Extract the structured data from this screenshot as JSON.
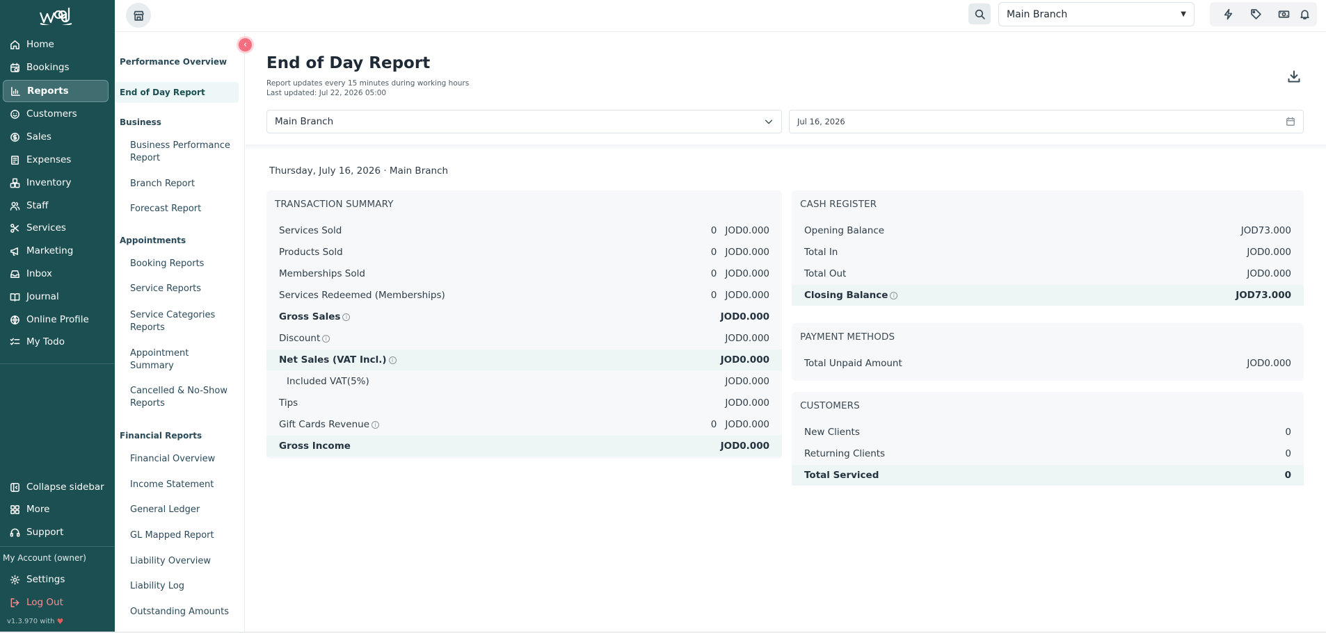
{
  "brand": {
    "logo_text": "waq"
  },
  "nav": {
    "items": [
      {
        "label": "Home",
        "icon": "home-icon"
      },
      {
        "label": "Bookings",
        "icon": "calendar-icon"
      },
      {
        "label": "Reports",
        "icon": "bar-chart-icon",
        "active": true
      },
      {
        "label": "Customers",
        "icon": "smile-icon"
      },
      {
        "label": "Sales",
        "icon": "coin-icon"
      },
      {
        "label": "Expenses",
        "icon": "receipt-icon"
      },
      {
        "label": "Inventory",
        "icon": "boxes-icon"
      },
      {
        "label": "Staff",
        "icon": "users-icon"
      },
      {
        "label": "Services",
        "icon": "scissors-icon"
      },
      {
        "label": "Marketing",
        "icon": "megaphone-icon"
      },
      {
        "label": "Inbox",
        "icon": "inbox-icon"
      },
      {
        "label": "Journal",
        "icon": "book-icon"
      },
      {
        "label": "Online Profile",
        "icon": "globe-icon"
      },
      {
        "label": "My Todo",
        "icon": "checklist-icon"
      }
    ],
    "bottom": {
      "collapse": "Collapse sidebar",
      "more": "More",
      "support": "Support",
      "account": "My Account  (owner)",
      "settings": "Settings",
      "logout": "Log Out",
      "version": "v1.3.970 with"
    }
  },
  "subnav": {
    "performance_overview": "Performance Overview",
    "active_item": "End of Day Report",
    "business": {
      "heading": "Business",
      "items": [
        "Business Performance Report",
        "Branch Report",
        "Forecast Report"
      ]
    },
    "appointments": {
      "heading": "Appointments",
      "items": [
        "Booking Reports",
        "Service Reports",
        "Service Categories Reports",
        "Appointment Summary",
        "Cancelled & No-Show Reports"
      ]
    },
    "financial": {
      "heading": "Financial Reports",
      "items": [
        "Financial Overview",
        "Income Statement",
        "General Ledger",
        "GL Mapped Report",
        "Liability Overview",
        "Liability Log",
        "Outstanding Amounts"
      ]
    }
  },
  "topbar": {
    "branch": "Main Branch"
  },
  "page": {
    "title": "End of Day Report",
    "note_1": "Report updates every 15 minutes during working hours",
    "note_2": "Last updated: Jul 22, 2026 05:00",
    "filter_branch": "Main Branch",
    "filter_date": "Jul 16, 2026",
    "date_line": "Thursday, July 16, 2026 · Main Branch"
  },
  "transaction_summary": {
    "title": "TRANSACTION SUMMARY",
    "rows": [
      {
        "label": "Services Sold",
        "count": "0",
        "amount": "JOD0.000"
      },
      {
        "label": "Products Sold",
        "count": "0",
        "amount": "JOD0.000"
      },
      {
        "label": "Memberships Sold",
        "count": "0",
        "amount": "JOD0.000"
      },
      {
        "label": "Services Redeemed (Memberships)",
        "count": "0",
        "amount": "JOD0.000"
      },
      {
        "label": "Gross Sales",
        "count": "",
        "amount": "JOD0.000"
      },
      {
        "label": "Discount",
        "count": "",
        "amount": "JOD0.000"
      },
      {
        "label": "Net Sales (VAT Incl.)",
        "count": "",
        "amount": "JOD0.000"
      },
      {
        "label": "Included VAT(5%)",
        "count": "",
        "amount": "JOD0.000"
      },
      {
        "label": "Tips",
        "count": "",
        "amount": "JOD0.000"
      },
      {
        "label": "Gift Cards Revenue",
        "count": "0",
        "amount": "JOD0.000"
      },
      {
        "label": "Gross Income",
        "count": "",
        "amount": "JOD0.000"
      }
    ]
  },
  "cash_register": {
    "title": "CASH REGISTER",
    "rows": [
      {
        "label": "Opening Balance",
        "amount": "JOD73.000"
      },
      {
        "label": "Total In",
        "amount": "JOD0.000"
      },
      {
        "label": "Total Out",
        "amount": "JOD0.000"
      },
      {
        "label": "Closing Balance",
        "amount": "JOD73.000"
      }
    ]
  },
  "payment_methods": {
    "title": "PAYMENT METHODS",
    "rows": [
      {
        "label": "Total Unpaid Amount",
        "amount": "JOD0.000"
      }
    ]
  },
  "customers": {
    "title": "CUSTOMERS",
    "rows": [
      {
        "label": "New Clients",
        "amount": "0"
      },
      {
        "label": "Returning Clients",
        "amount": "0"
      },
      {
        "label": "Total Serviced",
        "amount": "0"
      }
    ]
  },
  "colors": {
    "sidebar": "#1c4f52",
    "active_nav": "#3f6d70",
    "collapse_button": "#f36f7f",
    "highlight_row": "#eef6f5",
    "card_bg": "#f6f8f9"
  }
}
